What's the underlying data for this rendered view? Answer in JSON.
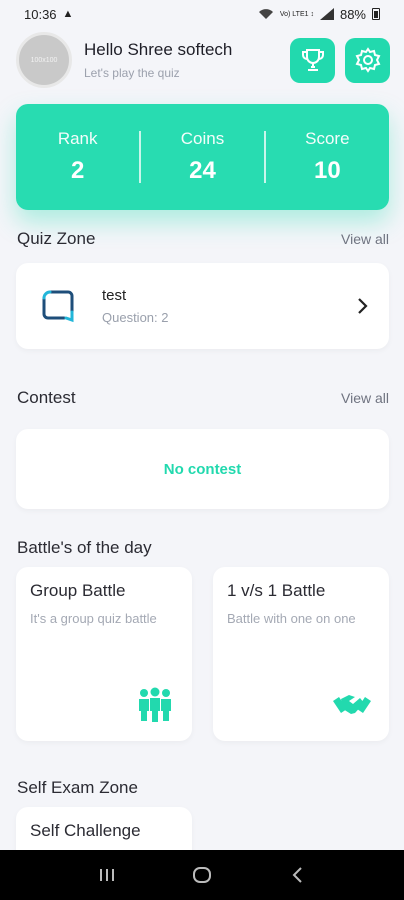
{
  "status_bar": {
    "time": "10:36",
    "alert": "▲",
    "signal_text": "Vo) LTE1 ↕",
    "battery_pct": "88%"
  },
  "header": {
    "avatar_text": "100x100",
    "title": "Hello Shree softech",
    "subtitle": "Let's play the quiz",
    "trophy_icon": "trophy-icon",
    "settings_icon": "gear-icon"
  },
  "stats": [
    {
      "label": "Rank",
      "value": "2"
    },
    {
      "label": "Coins",
      "value": "24"
    },
    {
      "label": "Score",
      "value": "10"
    }
  ],
  "quiz_zone": {
    "title": "Quiz Zone",
    "view_all": "View all",
    "item": {
      "name": "test",
      "subtitle": "Question: 2"
    }
  },
  "contest": {
    "title": "Contest",
    "view_all": "View all",
    "empty_text": "No contest"
  },
  "battles": {
    "title": "Battle's of the day",
    "items": [
      {
        "title": "Group Battle",
        "subtitle": "It's a group quiz battle",
        "icon": "group-people-icon"
      },
      {
        "title": "1 v/s 1 Battle",
        "subtitle": "Battle with one on one",
        "icon": "handshake-icon"
      }
    ]
  },
  "self_exam": {
    "title": "Self Exam Zone",
    "card_title": "Self Challenge"
  },
  "colors": {
    "accent": "#28dcb1",
    "background": "#f4f5f9"
  }
}
